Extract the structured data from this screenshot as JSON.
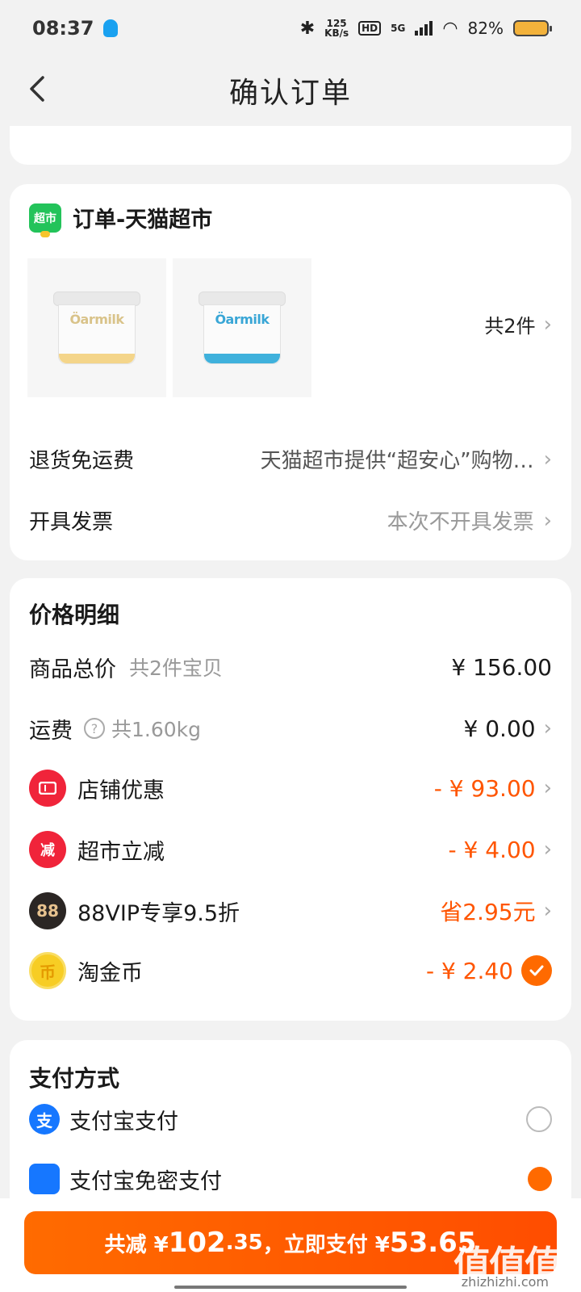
{
  "status_bar": {
    "time": "08:37",
    "net_speed_top": "125",
    "net_speed_bottom": "KB/s",
    "hd": "HD",
    "network": "5G",
    "battery": "82%"
  },
  "header": {
    "title": "确认订单",
    "back_icon": "chevron-left-icon"
  },
  "order": {
    "store_badge": "超市",
    "store_name": "订单-天猫超市",
    "products": [
      {
        "brand": "Öarmilk"
      },
      {
        "brand": "Öarmilk"
      }
    ],
    "item_count": "共2件",
    "return_label": "退货免运费",
    "return_value": "天猫超市提供“超安心”购物…",
    "invoice_label": "开具发票",
    "invoice_value": "本次不开具发票"
  },
  "price": {
    "title": "价格明细",
    "rows": [
      {
        "label": "商品总价",
        "sub": "共2件宝贝",
        "amount": "¥ 156.00"
      },
      {
        "label": "运费",
        "sub": "共1.60kg",
        "amount": "¥ 0.00"
      },
      {
        "label": "店铺优惠",
        "amount": "- ¥ 93.00",
        "icon": "ticket-icon"
      },
      {
        "label": "超市立减",
        "amount": "- ¥ 4.00",
        "icon": "reduce-icon",
        "icon_text": "减"
      },
      {
        "label": "88VIP专享9.5折",
        "amount": "省2.95元",
        "icon": "vip-icon",
        "icon_text": "88"
      },
      {
        "label": "淘金币",
        "amount": "- ¥ 2.40",
        "icon": "coin-icon",
        "icon_text": "币"
      }
    ]
  },
  "payment": {
    "title": "支付方式",
    "alipay_label": "支付宝支付",
    "alipay_icon_text": "支",
    "second_label": "支付宝免密支付"
  },
  "bottom": {
    "prefix": "共减 ¥",
    "saved_big": "102",
    "saved_small": ".35",
    "middle": "，立即支付 ¥",
    "pay_big": "53.65",
    "watermark": "值值值",
    "watermark_sub": "zhizhizhi.com"
  },
  "colors": {
    "accent": "#ff5500",
    "button": "#ff6b00",
    "store_green": "#23c35a",
    "alipay_blue": "#1677ff"
  }
}
